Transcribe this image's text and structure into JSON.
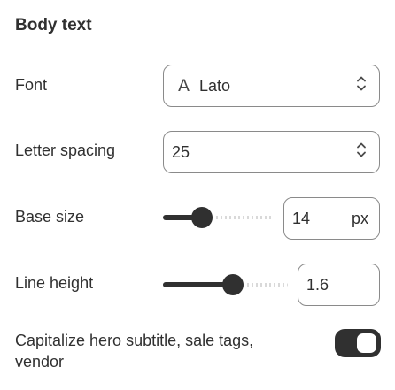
{
  "section": {
    "title": "Body text"
  },
  "font": {
    "label": "Font",
    "value": "Lato",
    "icon": "font-letter-a-icon",
    "icon_glyph": "A"
  },
  "letter_spacing": {
    "label": "Letter spacing",
    "value": "25"
  },
  "base_size": {
    "label": "Base size",
    "value": "14",
    "unit": "px",
    "slider_fraction": 0.32
  },
  "line_height": {
    "label": "Line height",
    "value": "1.6",
    "slider_fraction": 0.57
  },
  "capitalize": {
    "label": "Capitalize hero subtitle, sale tags, vendor",
    "enabled": true
  },
  "colors": {
    "text": "#303030",
    "border": "#8a8a8a",
    "accent": "#303030"
  }
}
